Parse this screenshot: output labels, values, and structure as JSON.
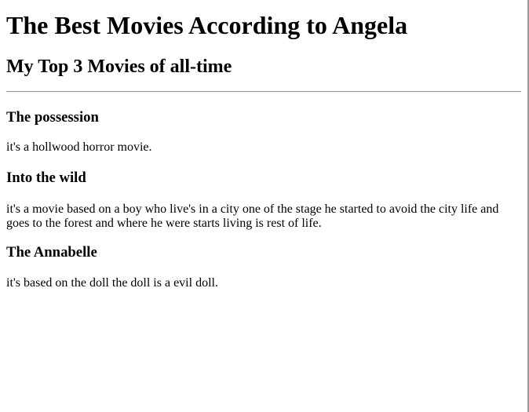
{
  "page": {
    "title": "The Best Movies According to Angela",
    "subtitle": "My Top 3 Movies of all-time"
  },
  "movies": [
    {
      "title": "The possession",
      "description": "it's a hollwood horror movie."
    },
    {
      "title": "Into the wild",
      "description": "it's a movie based on a boy who live's in a city one of the stage he started to avoid the city life and goes to the forest and where he were starts living is rest of life."
    },
    {
      "title": "The Annabelle",
      "description": "it's based on the doll the doll is a evil doll."
    }
  ]
}
